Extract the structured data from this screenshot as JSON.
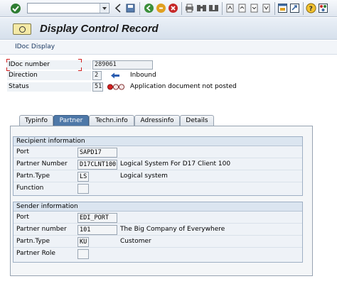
{
  "toolbar": {
    "command_value": "",
    "icons": [
      "check-icon",
      "back-icon",
      "save-icon",
      "exit-icon",
      "cancel-icon",
      "stop-icon",
      "print-icon",
      "find-icon",
      "find-next-icon",
      "first-page-icon",
      "prev-page-icon",
      "next-page-icon",
      "last-page-icon",
      "create-session-icon",
      "shortcut-icon",
      "help-icon",
      "layout-icon"
    ]
  },
  "title": "Display Control Record",
  "appbar": {
    "label": "IDoc Display"
  },
  "header": {
    "idoc_label": "IDoc number",
    "idoc_value": "289061",
    "direction_label": "Direction",
    "direction_value": "2",
    "direction_text": "Inbound",
    "status_label": "Status",
    "status_value": "51",
    "status_text": "Application document not posted"
  },
  "tabs": [
    "Typinfo",
    "Partner",
    "Techn.info",
    "Adressinfo",
    "Details"
  ],
  "active_tab": "Partner",
  "recipient": {
    "title": "Recipient information",
    "rows": [
      {
        "label": "Port",
        "value": "SAPD17",
        "text": ""
      },
      {
        "label": "Partner Number",
        "value": "D17CLNT100",
        "text": "Logical System For D17 Client 100"
      },
      {
        "label": "Partn.Type",
        "value": "LS",
        "text": "Logical system"
      },
      {
        "label": "Function",
        "value": "",
        "text": ""
      }
    ]
  },
  "sender": {
    "title": "Sender information",
    "rows": [
      {
        "label": "Port",
        "value": "EDI_PORT",
        "text": ""
      },
      {
        "label": "Partner number",
        "value": "101",
        "text": "The Big Company of Everywhere"
      },
      {
        "label": "Partn.Type",
        "value": "KU",
        "text": "Customer"
      },
      {
        "label": "Partner Role",
        "value": "",
        "text": ""
      }
    ]
  }
}
